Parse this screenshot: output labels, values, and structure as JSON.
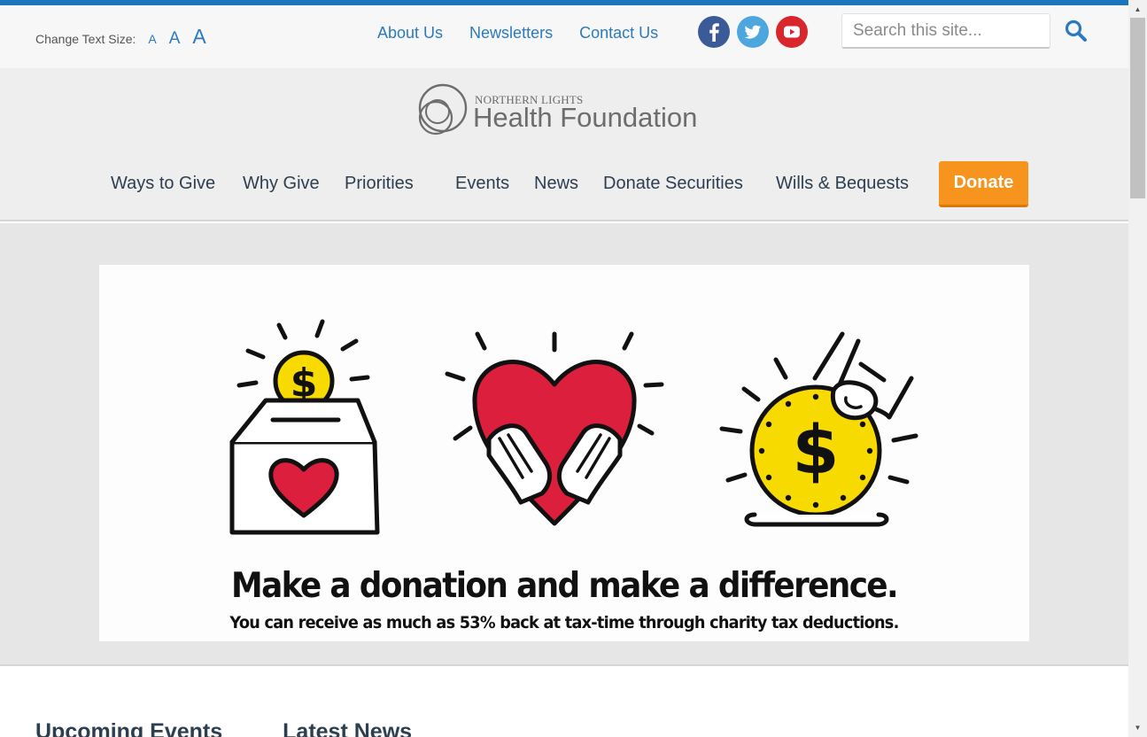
{
  "utility": {
    "text_size_label": "Change Text Size:",
    "text_sizes": [
      "A",
      "A",
      "A"
    ],
    "links": [
      "About Us",
      "Newsletters",
      "Contact Us"
    ],
    "search_placeholder": "Search this site..."
  },
  "social": [
    "facebook-icon",
    "twitter-icon",
    "youtube-icon"
  ],
  "logo": {
    "top_line": "NORTHERN LIGHTS",
    "name": "Health Foundation"
  },
  "nav": {
    "items": [
      "Ways to Give",
      "Why Give",
      "Priorities",
      "Events",
      "News",
      "Donate Securities",
      "Wills & Bequests"
    ],
    "donate_label": "Donate"
  },
  "banner": {
    "headline": "Make a donation and make a difference.",
    "subline": "You can receive as much as 53% back at tax-time through charity tax deductions."
  },
  "sections": {
    "events_heading": "Upcoming Events",
    "news_heading": "Latest News"
  },
  "colors": {
    "accent_blue": "#1b75bc",
    "link_blue": "#2a7ac0",
    "donate_orange": "#f7941d",
    "nav_text": "#2d3e50",
    "heart_red": "#dc1f3c",
    "coin_yellow": "#f7da00"
  }
}
